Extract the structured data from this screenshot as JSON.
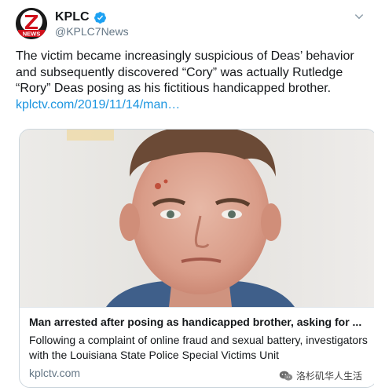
{
  "account": {
    "display_name": "KPLC",
    "handle": "@KPLC7News",
    "avatar_logo_text": "Z NEWS",
    "verified": true,
    "accent_color": "#1da1f2"
  },
  "tweet": {
    "text": "The victim became increasingly suspicious of Deas’ behavior and subsequently discovered “Cory” was actually Rutledge “Rory” Deas posing as his fictitious handicapped brother.",
    "link_text": "kplctv.com/2019/11/14/man…",
    "link_color": "#1b95e0"
  },
  "card": {
    "title": "Man arrested after posing as handicapped brother, asking for ...",
    "description": "Following a complaint of online fraud and sexual battery, investigators with the Louisiana State Police Special Victims Unit",
    "domain": "kplctv.com"
  },
  "watermark": {
    "text": "洛杉矶华人生活",
    "icon": "wechat-icon"
  }
}
